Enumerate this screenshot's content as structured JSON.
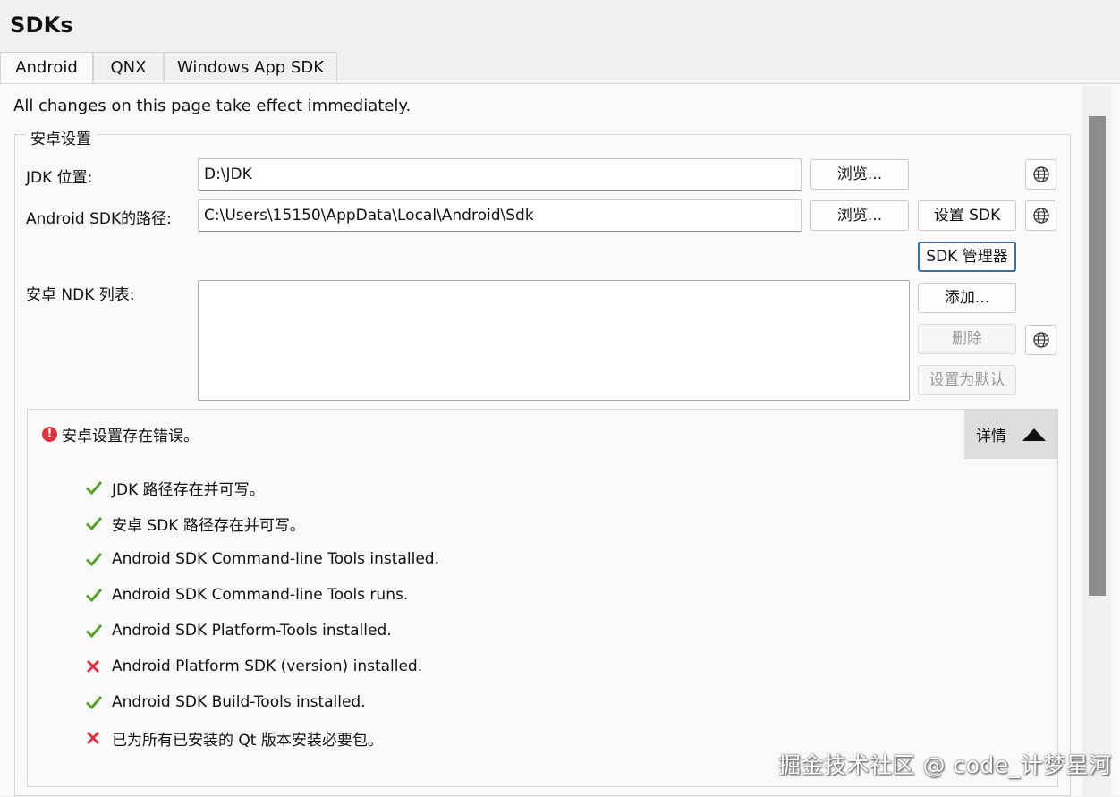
{
  "page": {
    "title": "SDKs"
  },
  "tabs": [
    {
      "label": "Android",
      "active": true
    },
    {
      "label": "QNX",
      "active": false
    },
    {
      "label": "Windows App SDK",
      "active": false
    }
  ],
  "notice": "All changes on this page take effect immediately.",
  "android": {
    "group_title": "安卓设置",
    "jdk_label": "JDK 位置:",
    "jdk_value": "D:\\JDK",
    "sdk_label": "Android SDK的路径:",
    "sdk_value": "C:\\Users\\15150\\AppData\\Local\\Android\\Sdk",
    "ndk_label": "安卓 NDK 列表:",
    "browse_label": "浏览...",
    "setup_sdk_label": "设置 SDK",
    "sdk_manager_label": "SDK 管理器",
    "add_label": "添加...",
    "remove_label": "删除",
    "set_default_label": "设置为默认"
  },
  "summary": {
    "status_text": "安卓设置存在错误。",
    "details_label": "详情",
    "checks": [
      {
        "text": "JDK 路径存在并可写。",
        "ok": true
      },
      {
        "text": "安卓 SDK 路径存在并可写。",
        "ok": true
      },
      {
        "text": "Android SDK Command-line Tools installed.",
        "ok": true
      },
      {
        "text": "Android SDK Command-line Tools runs.",
        "ok": true
      },
      {
        "text": "Android SDK Platform-Tools installed.",
        "ok": true
      },
      {
        "text": "Android Platform SDK (version) installed.",
        "ok": false
      },
      {
        "text": "Android SDK Build-Tools installed.",
        "ok": true
      },
      {
        "text": "已为所有已安装的 Qt 版本安装必要包。",
        "ok": false
      }
    ]
  },
  "colors": {
    "ok": "#5aa02c",
    "error": "#d9363e"
  },
  "watermark": "掘金技术社区 @ code_计梦星河"
}
